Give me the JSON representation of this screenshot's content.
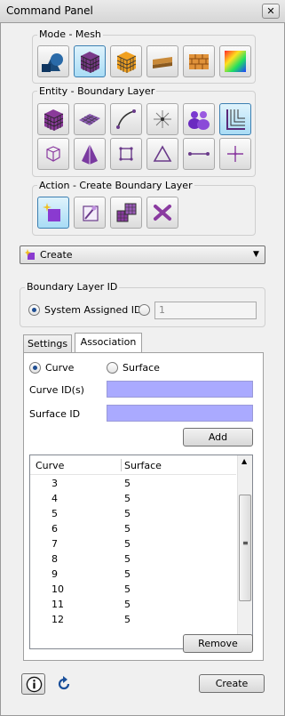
{
  "window": {
    "title": "Command Panel",
    "close_icon": "close-icon"
  },
  "mode": {
    "legend": "Mode - Mesh",
    "buttons": [
      "mesh-sphere-icon",
      "mesh-cube-icon",
      "mesh-grid-cube-icon",
      "mesh-sweep-icon",
      "mesh-brick-icon",
      "mesh-quality-icon"
    ],
    "selected_index": 1
  },
  "entity": {
    "legend": "Entity - Boundary Layer",
    "row1": [
      "volume-icon",
      "surface-icon",
      "curve-icon",
      "vertex-icon",
      "group-icon",
      "boundary-layer-icon"
    ],
    "row2": [
      "hex-icon",
      "tet-icon",
      "face-icon",
      "tri-icon",
      "edge-icon",
      "node-icon"
    ],
    "selected": "boundary-layer-icon"
  },
  "action": {
    "legend": "Action - Create Boundary Layer",
    "buttons": [
      "create-icon",
      "modify-icon",
      "copy-icon",
      "delete-icon"
    ],
    "selected_index": 0
  },
  "dropdown": {
    "selected": "Create"
  },
  "boundary_layer_id": {
    "legend": "Boundary Layer ID",
    "system_assigned_label": "System Assigned ID",
    "id_value": "1"
  },
  "tabs": [
    {
      "label": "Settings"
    },
    {
      "label": "Association"
    }
  ],
  "association": {
    "curve_label": "Curve",
    "surface_label": "Surface",
    "curve_ids_label": "Curve ID(s)",
    "surface_id_label": "Surface ID",
    "add_label": "Add",
    "remove_label": "Remove",
    "table": {
      "headers": [
        "Curve",
        "Surface"
      ],
      "rows": [
        [
          "3",
          "5"
        ],
        [
          "4",
          "5"
        ],
        [
          "5",
          "5"
        ],
        [
          "6",
          "5"
        ],
        [
          "7",
          "5"
        ],
        [
          "8",
          "5"
        ],
        [
          "9",
          "5"
        ],
        [
          "10",
          "5"
        ],
        [
          "11",
          "5"
        ],
        [
          "12",
          "5"
        ]
      ]
    }
  },
  "footer": {
    "info_icon": "info-icon",
    "refresh_icon": "refresh-icon",
    "create_label": "Create"
  },
  "colors": {
    "selection": "#a9dcf5",
    "id_field": "#aaaaff"
  }
}
